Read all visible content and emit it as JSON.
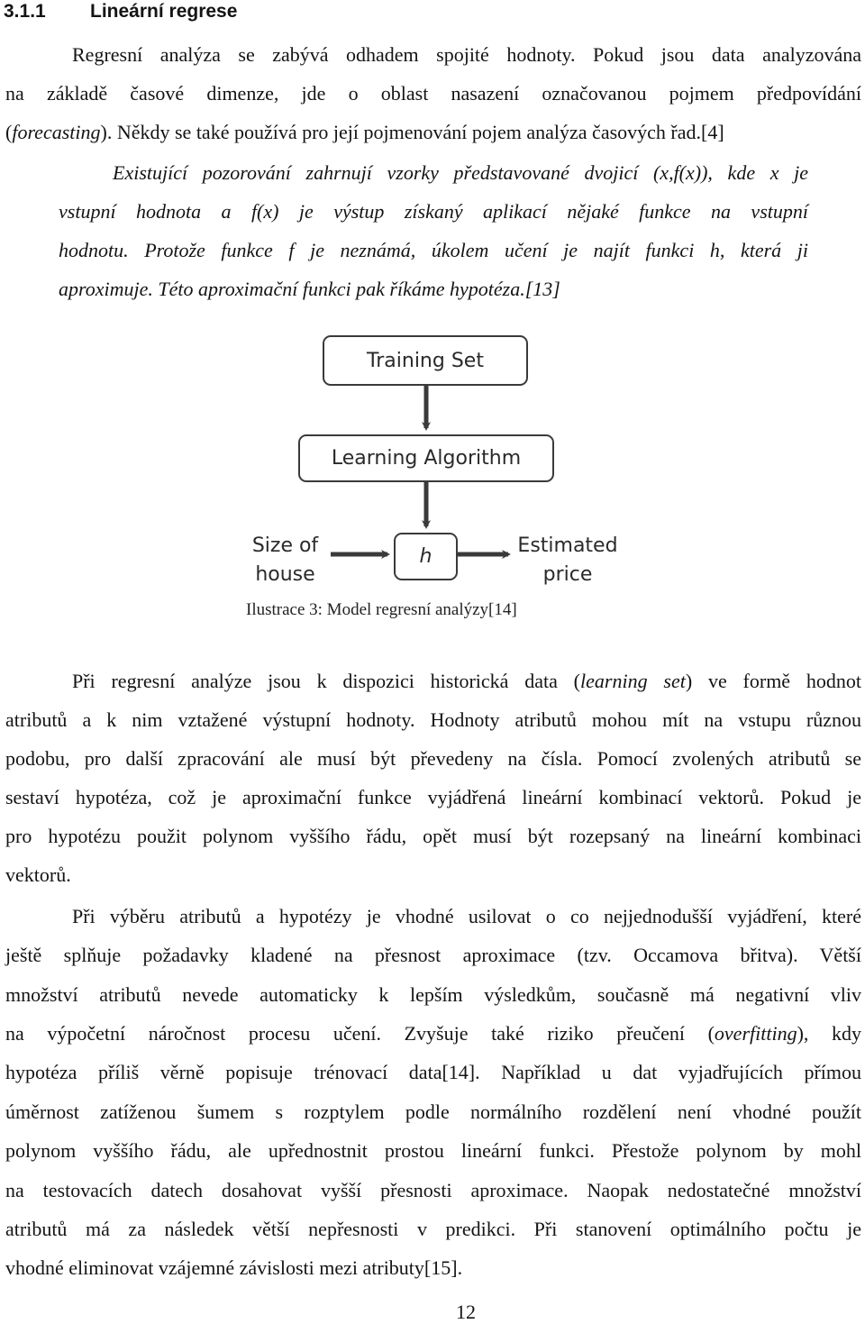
{
  "heading": {
    "number": "3.1.1",
    "title": "Lineární regrese"
  },
  "paragraph1": [
    "Regresní analýza se zabývá odhadem spojité hodnoty. Pokud jsou data analyzována",
    "na základě časové dimenze, jde o oblast nasazení označovanou pojmem předpovídání",
    {
      "pre": "(",
      "italic": "forecasting",
      "post": "). Někdy se také používá pro její pojmenování pojem analýza časových řad.[4]"
    }
  ],
  "quote": [
    "Existující pozorování zahrnují vzorky představované dvojicí (x,f(x)), kde x je",
    "vstupní hodnota a f(x) je výstup získaný aplikací nějaké funkce na vstupní",
    "hodnotu. Protože funkce f je neznámá, úkolem učení je najít funkci h, která ji",
    "aproximuje. Této aproximační funkci pak říkáme hypotéza.[13]"
  ],
  "diagram": {
    "training_set": "Training Set",
    "learning_algorithm": "Learning Algorithm",
    "hypothesis": "h",
    "input_label_1": "Size of",
    "input_label_2": "house",
    "output_label_1": "Estimated",
    "output_label_2": "price"
  },
  "caption": "Ilustrace 3: Model regresní analýzy[14]",
  "paragraph2": [
    {
      "pre": "Při regresní analýze jsou k dispozici historická data (",
      "italic": "learning set",
      "post": ") ve formě hodnot"
    },
    "atributů a k nim vztažené výstupní hodnoty. Hodnoty atributů mohou mít na vstupu různou",
    "podobu, pro další zpracování ale musí být převedeny na čísla. Pomocí zvolených atributů se",
    "sestaví hypotéza, což je aproximační funkce vyjádřená lineární kombinací vektorů. Pokud je",
    "pro hypotézu použit polynom vyššího řádu, opět musí být rozepsaný na lineární kombinaci",
    "vektorů."
  ],
  "paragraph3": [
    "Při výběru atributů a hypotézy je vhodné usilovat o co nejjednodušší vyjádření, které",
    "ještě splňuje požadavky kladené na přesnost aproximace (tzv. Occamova břitva). Větší",
    "množství atributů nevede automaticky k lepším výsledkům, současně má negativní vliv",
    {
      "pre": "na výpočetní náročnost procesu učení. Zvyšuje také riziko přeučení (",
      "italic": "overfitting",
      "post": "), kdy"
    },
    "hypotéza příliš věrně popisuje trénovací data[14]. Například u dat vyjadřujících přímou",
    "úměrnost zatíženou šumem s rozptylem podle normálního rozdělení není vhodné použít",
    "polynom vyššího řádu, ale upřednostnit prostou lineární funkci. Přestože polynom by mohl",
    "na testovacích datech dosahovat vyšší přesnosti aproximace. Naopak nedostatečné množství",
    "atributů má za následek větší nepřesnosti v predikci. Při stanovení optimálního počtu je",
    "vhodné eliminovat vzájemné závislosti mezi atributy[15]."
  ],
  "page_number": "12"
}
